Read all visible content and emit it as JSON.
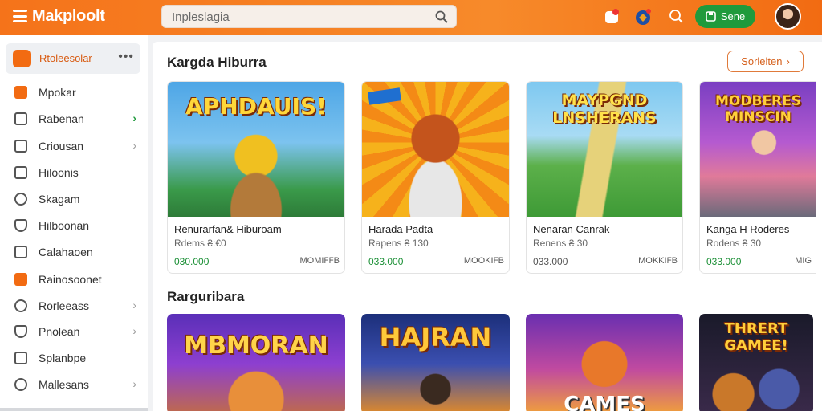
{
  "header": {
    "app_title": "Makploolt",
    "search_placeholder": "Inpleslagia",
    "save_label": "Sene"
  },
  "sidebar": {
    "top_label": "Rtoleesolar",
    "items": [
      {
        "label": "Mpokar",
        "chevron": ""
      },
      {
        "label": "Rabenan",
        "chevron": "›"
      },
      {
        "label": "Criousan",
        "chevron": "›"
      },
      {
        "label": "Hiloonis",
        "chevron": ""
      },
      {
        "label": "Skagam",
        "chevron": ""
      },
      {
        "label": "Hilboonan",
        "chevron": ""
      },
      {
        "label": "Calahaoen",
        "chevron": ""
      },
      {
        "label": "Rainosoonet",
        "chevron": ""
      },
      {
        "label": "Rorleeass",
        "chevron": "›"
      },
      {
        "label": "Pnolean",
        "chevron": "›"
      },
      {
        "label": "Splanbpe",
        "chevron": ""
      },
      {
        "label": "Mallesans",
        "chevron": "›"
      }
    ]
  },
  "main": {
    "section1_title": "Kargda Hiburra",
    "see_all_label": "Sorlelten",
    "section2_title": "Rarguribara",
    "cards": [
      {
        "thumb_text": "APHDAUIS!",
        "title": "Renurarfan& Hiburoam",
        "sub": "Rdems ₴:€0",
        "price": "030.000",
        "tag": "MOMI₣₣B"
      },
      {
        "thumb_text": "",
        "title": "Harada Padta",
        "sub": "Rapens ₴ 130",
        "price": "033.000",
        "tag": "MOOKI₣B"
      },
      {
        "thumb_text": "MAYPGND LNSHERANS",
        "title": "Nenaran Canrak",
        "sub": "Renens ₴ 30",
        "price": "033.000",
        "tag": "MOKKI₣B"
      },
      {
        "thumb_text": "MODBERES MINSCIN",
        "title": "Kanga H Roderes",
        "sub": "Rodens ₴ 30",
        "price": "033.000",
        "tag": "MIG"
      }
    ],
    "cards2": [
      {
        "thumb_text": "MBMORAN"
      },
      {
        "thumb_text": "HAJRAN"
      },
      {
        "thumb_text": "CAMES"
      },
      {
        "thumb_text": "THRERT GAMEE!"
      }
    ]
  }
}
